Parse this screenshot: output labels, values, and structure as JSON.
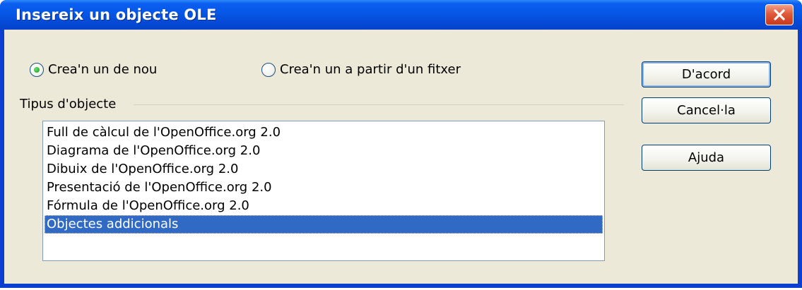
{
  "window": {
    "title": "Insereix un objecte OLE",
    "close_icon": "close-icon"
  },
  "options": {
    "create_new_label": "Crea'n un de nou",
    "create_from_file_label": "Crea'n un a partir d'un fitxer",
    "selected": "create_new"
  },
  "object_type": {
    "group_label": "Tipus d'objecte",
    "items": [
      "Full de càlcul de l'OpenOffice.org 2.0",
      "Diagrama de l'OpenOffice.org 2.0",
      "Dibuix de l'OpenOffice.org 2.0",
      "Presentació de l'OpenOffice.org 2.0",
      "Fórmula de l'OpenOffice.org 2.0",
      "Objectes addicionals"
    ],
    "selected_index": 5
  },
  "buttons": {
    "ok_label": "D'acord",
    "cancel_label": "Cancel·la",
    "help_label": "Ajuda"
  },
  "colors": {
    "title_bar": "#0657e6",
    "selection": "#316ac5",
    "dialog_face": "#ece9d8",
    "close_button": "#e05a3a"
  }
}
